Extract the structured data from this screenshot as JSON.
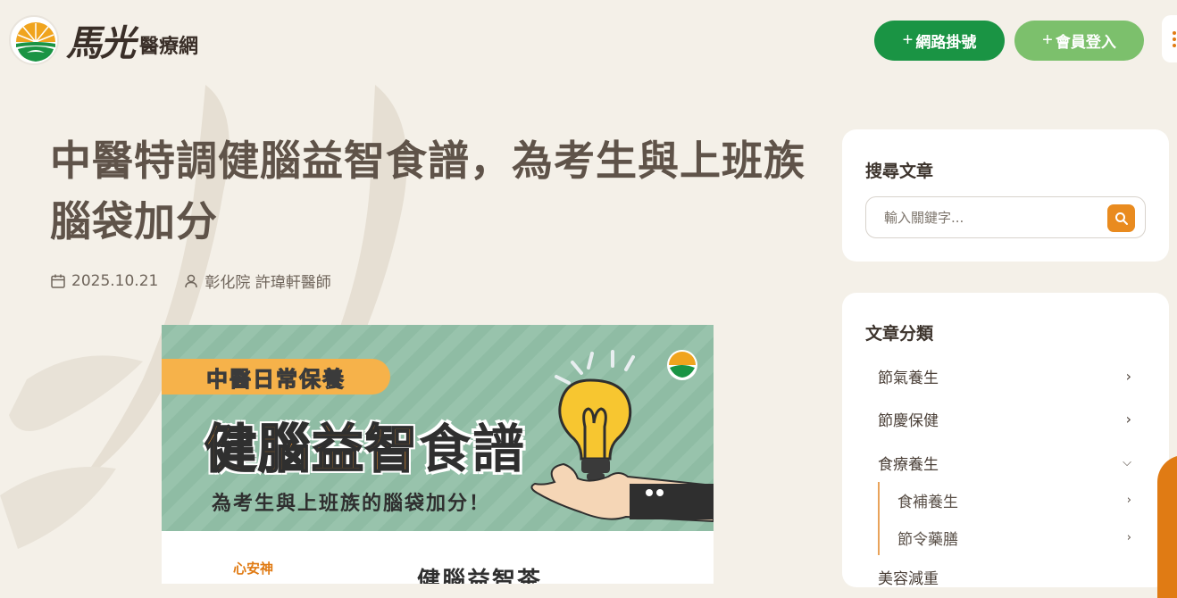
{
  "header": {
    "logo_script": "馬光",
    "logo_sub": "醫療網",
    "register_label": "網路掛號",
    "login_label": "會員登入",
    "plus": "+"
  },
  "article": {
    "title": "中醫特調健腦益智食譜，為考生與上班族腦袋加分",
    "date": "2025.10.21",
    "author": "彰化院 許瑋軒醫師"
  },
  "hero": {
    "tag": "中醫日常保養",
    "main_orange": "健腦益智",
    "main_dark": "食譜",
    "sub": "為考生與上班族的腦袋加分！",
    "sub2": "心安神",
    "sub3": "健腦益智茶"
  },
  "sidebar": {
    "search": {
      "title": "搜尋文章",
      "placeholder": "輸入關鍵字..."
    },
    "categories": {
      "title": "文章分類",
      "items": [
        {
          "label": "節氣養生"
        },
        {
          "label": "節慶保健"
        },
        {
          "label": "食療養生"
        }
      ],
      "subitems": [
        {
          "label": "食補養生"
        },
        {
          "label": "節令藥膳"
        }
      ],
      "partial_label": "美容減重"
    }
  },
  "colors": {
    "background": "#f4f0e8",
    "primary_green": "#1a9444",
    "light_green": "#7cc06c",
    "accent_orange": "#e98b1f"
  }
}
